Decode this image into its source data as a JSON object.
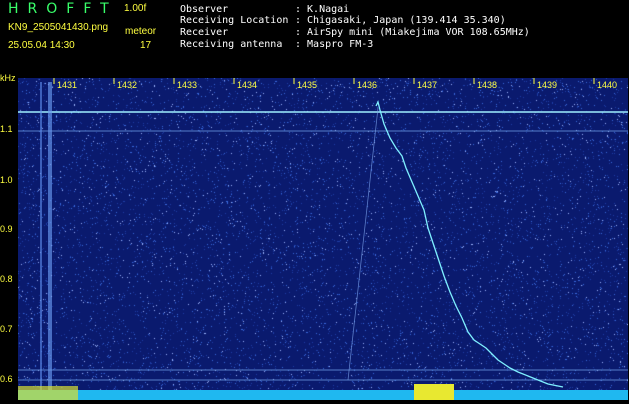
{
  "header": {
    "app_name": "HROFFT",
    "version": "1.00f",
    "file_name": "KN9_2505041430.png",
    "mode": "meteor",
    "datetime": "25.05.04 14:30",
    "count": "17",
    "info": [
      {
        "label": "Observer",
        "value": ": K.Nagai"
      },
      {
        "label": "Receiving Location",
        "value": ": Chigasaki, Japan (139.414 35.340)"
      },
      {
        "label": "Receiver",
        "value": ": AirSpy mini (Miakejima VOR 108.65MHz)"
      },
      {
        "label": "Receiving antenna",
        "value": ": Maspro FM-3"
      }
    ]
  },
  "spectrogram": {
    "y_unit": "kHz",
    "y_ticks": [
      "1.1",
      "1.0",
      "0.9",
      "0.8",
      "0.7",
      "0.6"
    ],
    "x_ticks": [
      "1431",
      "1432",
      "1433",
      "1434",
      "1435",
      "1436",
      "1437",
      "1438",
      "1439",
      "1440"
    ],
    "colors": {
      "background": "#0a1a6e",
      "noise": "#3a6adf",
      "trace": "#7ff0ff",
      "carrier": "#9ff0ff",
      "label": "#ffff40",
      "title": "#39ff6a"
    }
  }
}
